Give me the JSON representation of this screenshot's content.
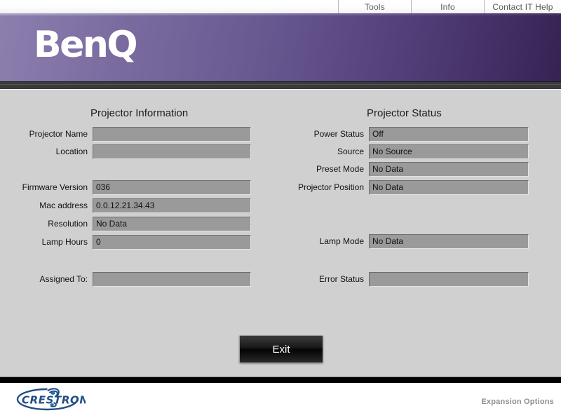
{
  "topnav": {
    "items": [
      {
        "label": "Tools",
        "name": "nav-tools"
      },
      {
        "label": "Info",
        "name": "nav-info"
      },
      {
        "label": "Contact IT Help",
        "name": "nav-contact-it-help"
      }
    ]
  },
  "banner": {
    "logo_text": "BenQ",
    "brand_color": "#6a5a92"
  },
  "panels": {
    "info": {
      "title": "Projector Information",
      "rows": [
        {
          "label": "Projector Name",
          "value": ""
        },
        {
          "label": "Location",
          "value": ""
        },
        {
          "label": "Firmware Version",
          "value": "036"
        },
        {
          "label": "Mac address",
          "value": "0.0.12.21.34.43"
        },
        {
          "label": "Resolution",
          "value": "No Data"
        },
        {
          "label": "Lamp Hours",
          "value": "0"
        },
        {
          "label": "Assigned To:",
          "value": ""
        }
      ]
    },
    "status": {
      "title": "Projector Status",
      "rows": [
        {
          "label": "Power Status",
          "value": "Off"
        },
        {
          "label": "Source",
          "value": "No Source"
        },
        {
          "label": "Preset Mode",
          "value": "No Data"
        },
        {
          "label": "Projector Position",
          "value": "No Data"
        },
        {
          "label": "Lamp Mode",
          "value": "No Data"
        },
        {
          "label": "Error Status",
          "value": ""
        }
      ]
    }
  },
  "actions": {
    "exit_label": "Exit"
  },
  "footer": {
    "logo_text": "CRESTRON",
    "expansion_label": "Expansion Options"
  }
}
